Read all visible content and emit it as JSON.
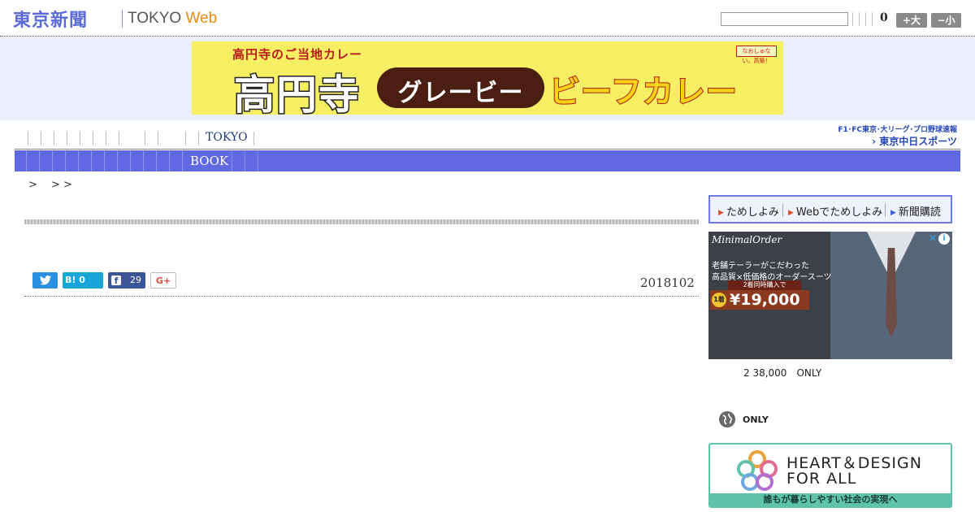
{
  "header": {
    "logo_jp": "東京新聞",
    "logo_en_main": "TOKYO ",
    "logo_en_accent": "Web",
    "search_value": "",
    "count": "0",
    "font_large": "+大",
    "font_small": "−小"
  },
  "banner": {
    "sub": "高円寺のご当地カレー",
    "badge": "なおしゅない。高築！",
    "kanji": "高円寺",
    "pill": "グレービー",
    "curry": "ビーフカレー"
  },
  "nav": {
    "tokyo_label": "TOKYO",
    "chunichi_top": "F1･FC東京･大リーグ･プロ野球速報",
    "chunichi_bottom": "› 東京中日スポーツ"
  },
  "subnav": {
    "book_label": "BOOK"
  },
  "breadcrumb": ">　 > >",
  "share": {
    "twitter_icon_text": "🐦",
    "hatena_label": "B! 0",
    "facebook_f": "f",
    "facebook_count": "29",
    "gplus_label": "G+"
  },
  "article": {
    "date": "2018102"
  },
  "sidebar": {
    "tame_items": [
      "ためしよみ",
      "Webでためしよみ",
      "新聞購読"
    ],
    "suit_ad": {
      "brand": "MinimalOrder",
      "line1": "老舗テーラーがこだわった",
      "line2": "高品質×低価格のオーダースーツ",
      "price_top": "2着同時購入で",
      "price_badge": "1着",
      "price": "¥19,000"
    },
    "only_text": "2 38,000　ONLY",
    "only_label": "ONLY",
    "heart_ad": {
      "title1": "HEART＆DESIGN",
      "title2": "FOR ALL",
      "bar": "誰もが暮らしやすい社会の実現へ"
    }
  },
  "colors": {
    "brand_blue": "#5a6ad8",
    "subnav_blue": "#6068e2",
    "banner_yellow": "#f6ef64",
    "heart_green": "#5ec3a8"
  }
}
